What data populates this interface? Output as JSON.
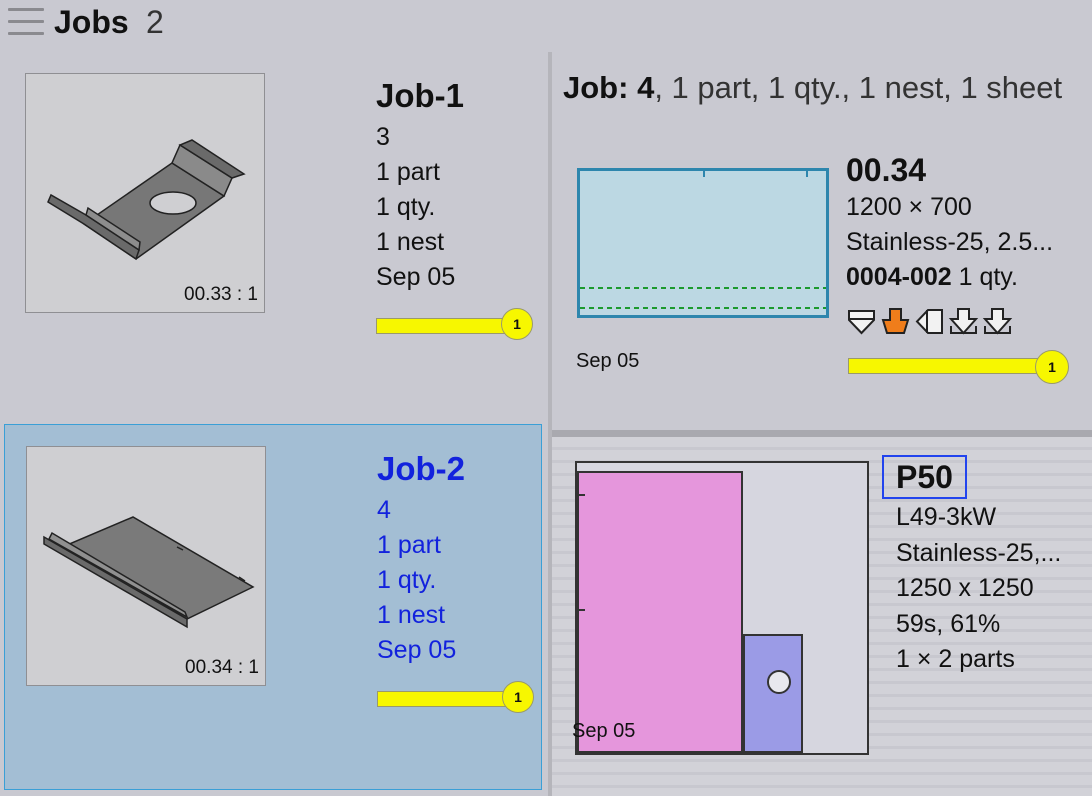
{
  "header": {
    "title": "Jobs",
    "count": "2"
  },
  "jobs": [
    {
      "name": "Job-1",
      "number": "3",
      "parts": "1 part",
      "qty": "1 qty.",
      "nests": "1 nest",
      "date": "Sep 05",
      "scale_label": "00.33 : 1",
      "progress_badge": "1",
      "selected": false
    },
    {
      "name": "Job-2",
      "number": "4",
      "parts": "1 part",
      "qty": "1 qty.",
      "nests": "1 nest",
      "date": "Sep 05",
      "scale_label": "00.34 : 1",
      "progress_badge": "1",
      "selected": true
    }
  ],
  "job_summary": {
    "label": "Job:",
    "number": "4",
    "rest": ", 1 part, 1 qty., 1 nest, 1 sheet"
  },
  "sheet": {
    "id": "00.34",
    "size": "1200 × 700",
    "material": "Stainless-25, 2.5...",
    "part_number": "0004-002",
    "qty": "1 qty.",
    "date": "Sep 05",
    "progress_badge": "1",
    "tool_icons": [
      "bend-down-icon",
      "bend-active-icon",
      "bend-left-icon",
      "bend-down-alt-icon",
      "bend-down-alt2-icon"
    ]
  },
  "program": {
    "name": "P50",
    "machine": "L49-3kW",
    "material": "Stainless-25,...",
    "sheet_size": "1250 x 1250",
    "time_util": "59s, 61%",
    "parts": "1 × 2 parts",
    "date": "Sep 05"
  },
  "colors": {
    "progress": "#f7f700",
    "selected_bg": "#a3bed4",
    "selected_text": "#1222dd",
    "nest_part": "#e596dc",
    "nest_part2": "#9b9be6",
    "sheet_fill": "#bcd8e3"
  }
}
